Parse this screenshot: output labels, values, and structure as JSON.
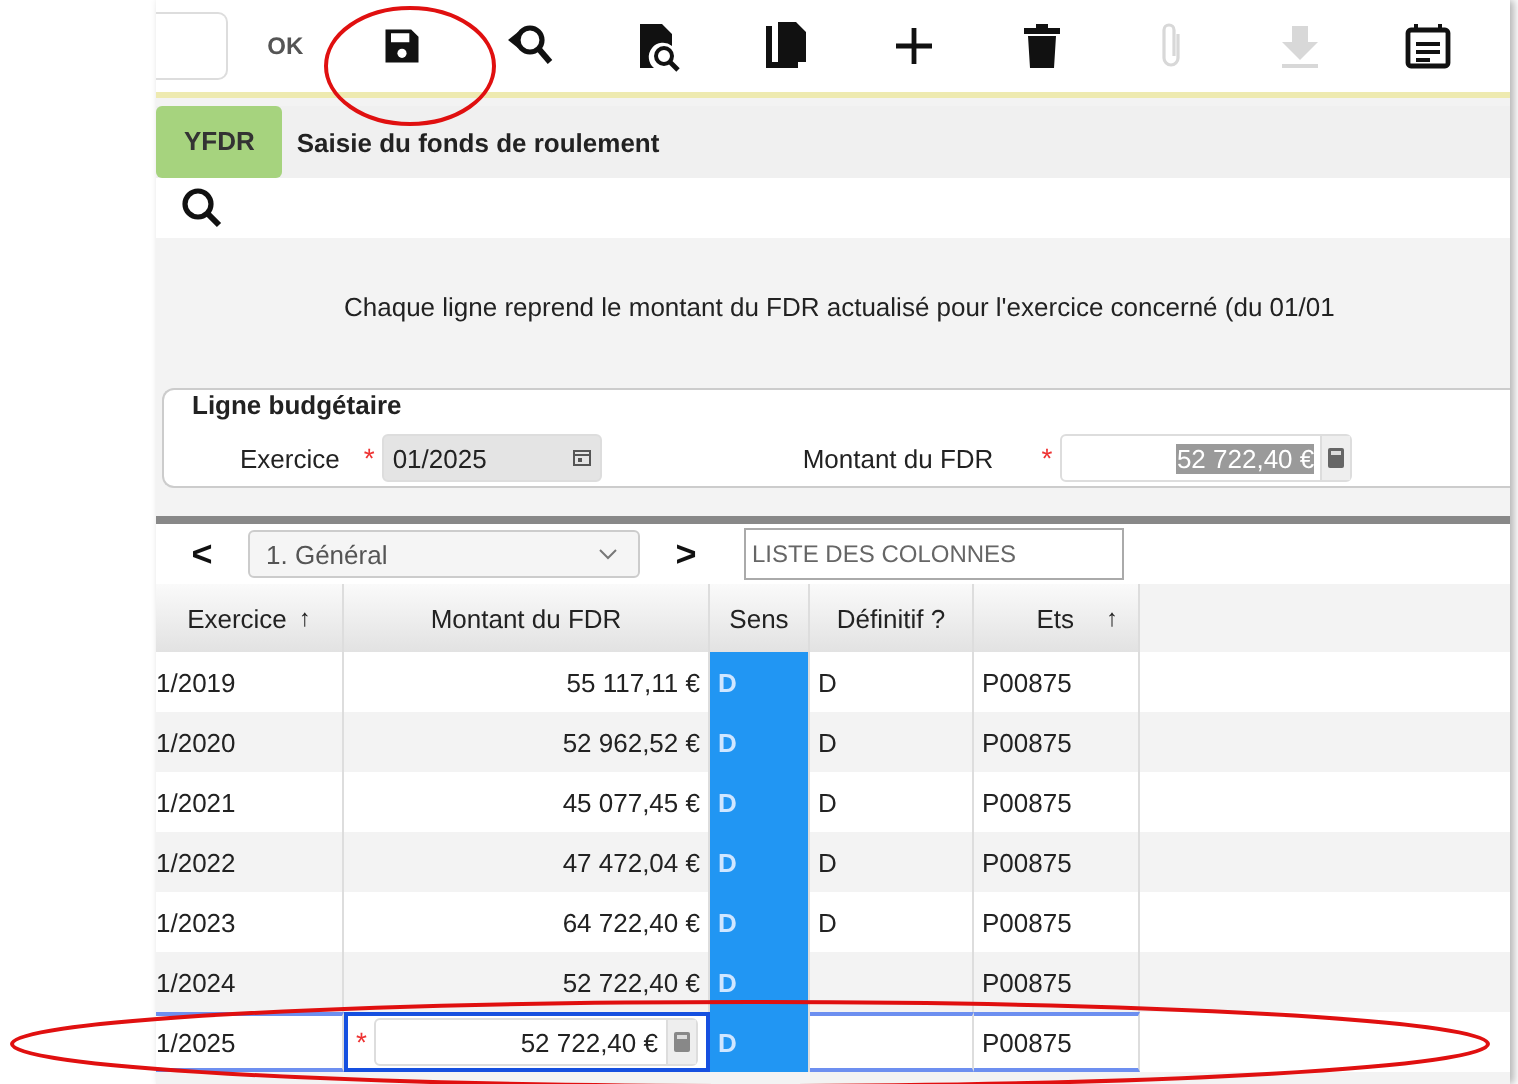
{
  "toolbar": {
    "ok_label": "OK",
    "buttons": [
      {
        "kind": "save",
        "disabled": false
      },
      {
        "kind": "undo-search",
        "disabled": false
      },
      {
        "kind": "doc-search",
        "disabled": false
      },
      {
        "kind": "copy",
        "disabled": false
      },
      {
        "kind": "plus",
        "disabled": false
      },
      {
        "kind": "trash",
        "disabled": false
      },
      {
        "kind": "attach",
        "disabled": true
      },
      {
        "kind": "download",
        "disabled": true
      },
      {
        "kind": "note",
        "disabled": false
      }
    ]
  },
  "header": {
    "code": "YFDR",
    "title": "Saisie du fonds de roulement"
  },
  "info": "Chaque ligne reprend le montant du FDR actualisé pour l'exercice concerné (du 01/01",
  "fieldset": {
    "legend": "Ligne budgétaire",
    "fields": [
      {
        "label": "Exercice",
        "value": "01/2025",
        "kind": "date",
        "required_mark": "*"
      },
      {
        "label": "Montant du FDR",
        "value": "52 722,40 €",
        "kind": "amount",
        "required_mark": "*"
      }
    ]
  },
  "nav": {
    "prev": "<",
    "next": ">",
    "view": "1. Général",
    "columns_field": {
      "placeholder": "LISTE DES COLONNES"
    }
  },
  "table": {
    "columns": [
      {
        "label": "Exercice",
        "sort": "↑"
      },
      {
        "label": "Montant du FDR"
      },
      {
        "label": "Sens"
      },
      {
        "label": "Définitif ?"
      },
      {
        "label": "Ets",
        "sort": "↑"
      }
    ],
    "rows": [
      {
        "exercice": "1/2019",
        "montant": "55 117,11 €",
        "sens": "D",
        "definitif": "D",
        "ets": "P00875",
        "editing": false
      },
      {
        "exercice": "1/2020",
        "montant": "52 962,52 €",
        "sens": "D",
        "definitif": "D",
        "ets": "P00875",
        "editing": false
      },
      {
        "exercice": "1/2021",
        "montant": "45 077,45 €",
        "sens": "D",
        "definitif": "D",
        "ets": "P00875",
        "editing": false
      },
      {
        "exercice": "1/2022",
        "montant": "47 472,04 €",
        "sens": "D",
        "definitif": "D",
        "ets": "P00875",
        "editing": false
      },
      {
        "exercice": "1/2023",
        "montant": "64 722,40 €",
        "sens": "D",
        "definitif": "D",
        "ets": "P00875",
        "editing": false
      },
      {
        "exercice": "1/2024",
        "montant": "52 722,40 €",
        "sens": "D",
        "ets": "P00875",
        "editing": false
      },
      {
        "exercice": "1/2025",
        "montant": "52 722,40 €",
        "sens": "D",
        "ets": "P00875",
        "editing": true,
        "required_mark": "*"
      }
    ]
  },
  "annotations": [
    {
      "kind": "ellipse"
    },
    {
      "kind": "ellipse"
    }
  ]
}
